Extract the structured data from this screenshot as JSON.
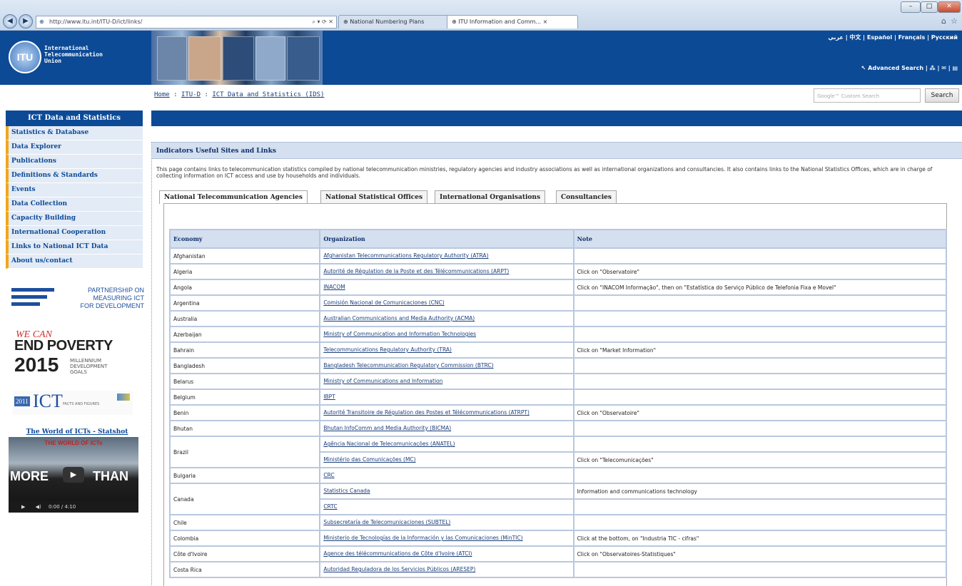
{
  "browser": {
    "url": "http://www.itu.int/ITU-D/ict/links/",
    "tabs": [
      {
        "label": "National Numbering Plans"
      },
      {
        "label": "ITU Information and Comm... ×"
      }
    ]
  },
  "header": {
    "logo_letters": "ITU",
    "org_name_lines": [
      "International",
      "Telecommunication",
      "Union"
    ],
    "languages": "عربي | 中文 | Español | Français | Русский",
    "advanced_search": "Advanced Search"
  },
  "breadcrumb": {
    "home": "Home",
    "sep1": " : ",
    "itud": "ITU-D",
    "sep2": " : ",
    "current": "ICT Data and Statistics (IDS)"
  },
  "search": {
    "placeholder": "Google™ Custom Search",
    "button": "Search"
  },
  "sidebar": {
    "title": "ICT Data and Statistics",
    "items": [
      {
        "label": "Statistics & Database"
      },
      {
        "label": "Data Explorer"
      },
      {
        "label": "Publications"
      },
      {
        "label": "Definitions & Standards"
      },
      {
        "label": "Events"
      },
      {
        "label": "Data Collection"
      },
      {
        "label": "Capacity Building"
      },
      {
        "label": "International Cooperation"
      },
      {
        "label": "Links to National ICT Data"
      },
      {
        "label": "About us/contact"
      }
    ],
    "partnership_lines": [
      "PARTNERSHIP ON",
      "MEASURING ICT",
      "FOR DEVELOPMENT"
    ],
    "mdg": {
      "we_can": "WE CAN",
      "end_poverty": "END POVERTY",
      "year": "2015",
      "subtitle_lines": [
        "MILLENNIUM",
        "DEVELOPMENT",
        "GOALS"
      ]
    },
    "ict_banner": {
      "year": "2011",
      "word": "ICT",
      "subtitle": "FACTS AND FIGURES"
    },
    "statshot_link": "The World of ICTs - Statshot",
    "video": {
      "top_text": "THE WORLD OF ICTs",
      "big_left": "MORE",
      "big_right": "THAN",
      "time": "0:00 / 4:10"
    }
  },
  "main": {
    "panel_title": "Indicators Useful Sites and Links",
    "intro": "This page contains links to telecommunication statistics compiled by national telecommunication ministries, regulatory agencies and industry associations as well as international organizations and consultancies. It also contains links to the National Statistics Offices, which are in charge of collecting information on ICT access and use by households and individuals.",
    "tabs": [
      {
        "label": "National Telecommunication Agencies"
      },
      {
        "label": "National Statistical Offices"
      },
      {
        "label": "International Organisations"
      },
      {
        "label": "Consultancies"
      }
    ],
    "table": {
      "headers": [
        "Economy",
        "Organization",
        "Note"
      ],
      "rows": [
        {
          "economy": "Afghanistan",
          "orgs": [
            "Afghanistan Telecommunications Regulatory Authority (ATRA)"
          ],
          "notes": [
            ""
          ]
        },
        {
          "economy": "Algeria",
          "orgs": [
            "Autorité de Régulation de la Poste et des Télécommunications (ARPT)"
          ],
          "notes": [
            "Click on \"Observatoire\""
          ]
        },
        {
          "economy": "Angola",
          "orgs": [
            "INACOM"
          ],
          "notes": [
            "Click on \"INACOM Informação\", then on \"Estatística do Serviço Público de Telefonia Fixa e Movel\""
          ]
        },
        {
          "economy": "Argentina",
          "orgs": [
            "Comisión Nacional de Comunicaciones (CNC)"
          ],
          "notes": [
            ""
          ]
        },
        {
          "economy": "Australia",
          "orgs": [
            "Australian Communications and Media Authority (ACMA)"
          ],
          "notes": [
            ""
          ]
        },
        {
          "economy": "Azerbaijan",
          "orgs": [
            "Ministry of Communication and Information Technologies"
          ],
          "notes": [
            ""
          ]
        },
        {
          "economy": "Bahrain",
          "orgs": [
            "Telecommunications Regulatory Authority (TRA)"
          ],
          "notes": [
            "Click on \"Market Information\""
          ]
        },
        {
          "economy": "Bangladesh",
          "orgs": [
            "Bangladesh Telecommunication Regulatory Commission (BTRC)"
          ],
          "notes": [
            ""
          ]
        },
        {
          "economy": "Belarus",
          "orgs": [
            "Ministry of Communications and Information"
          ],
          "notes": [
            ""
          ]
        },
        {
          "economy": "Belgium",
          "orgs": [
            "IBPT"
          ],
          "notes": [
            ""
          ]
        },
        {
          "economy": "Benin",
          "orgs": [
            "Autorité Transitoire de Régulation des Postes et Télécommunications (ATRPT)"
          ],
          "notes": [
            "Click on \"Observatoire\""
          ]
        },
        {
          "economy": "Bhutan",
          "orgs": [
            "Bhutan InfoComm and Media Authority (BICMA)"
          ],
          "notes": [
            ""
          ]
        },
        {
          "economy": "Brazil",
          "orgs": [
            "Agência Nacional de Telecomunicações (ANATEL)",
            "Ministério das Comunicações (MC)"
          ],
          "notes": [
            "",
            "Click on \"Telecomunicações\""
          ]
        },
        {
          "economy": "Bulgaria",
          "orgs": [
            "CRC"
          ],
          "notes": [
            ""
          ]
        },
        {
          "economy": "Canada",
          "orgs": [
            "Statistics Canada",
            "CRTC"
          ],
          "notes": [
            "Information and communications technology",
            ""
          ]
        },
        {
          "economy": "Chile",
          "orgs": [
            "Subsecretaría de Telecomunicaciones (SUBTEL)"
          ],
          "notes": [
            ""
          ]
        },
        {
          "economy": "Colombia",
          "orgs": [
            "Ministerio de Tecnologías de la Información y las Comunicaciones (MinTIC)"
          ],
          "notes": [
            "Click at the bottom, on \"Industria TIC - cifras\""
          ]
        },
        {
          "economy": "Côte d'Ivoire",
          "orgs": [
            "Agence des télécommunications de Côte d'Ivoire (ATCI)"
          ],
          "notes": [
            "Click on \"Observatoires-Statistiques\""
          ]
        },
        {
          "economy": "Costa Rica",
          "orgs": [
            "Autoridad Reguladora de los Servicios Públicos (ARESEP)"
          ],
          "notes": [
            ""
          ]
        }
      ]
    }
  }
}
